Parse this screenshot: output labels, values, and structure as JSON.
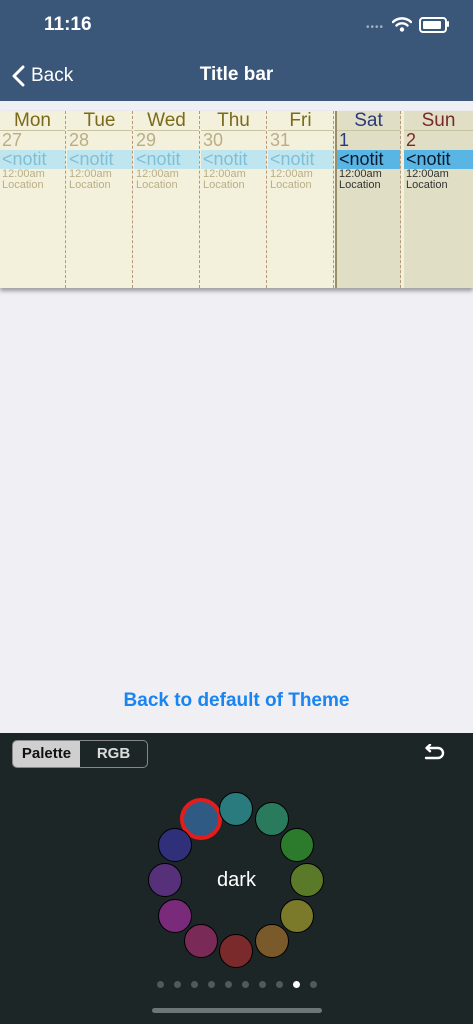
{
  "status": {
    "time": "11:16",
    "signal": "••••"
  },
  "nav": {
    "back_label": "Back",
    "title": "Title bar"
  },
  "calendar": {
    "days": [
      {
        "dow": "Mon",
        "date": "27",
        "event": "<notit",
        "time": "12:00am",
        "location": "Location"
      },
      {
        "dow": "Tue",
        "date": "28",
        "event": "<notit",
        "time": "12:00am",
        "location": "Location"
      },
      {
        "dow": "Wed",
        "date": "29",
        "event": "<notit",
        "time": "12:00am",
        "location": "Location"
      },
      {
        "dow": "Thu",
        "date": "30",
        "event": "<notit",
        "time": "12:00am",
        "location": "Location"
      },
      {
        "dow": "Fri",
        "date": "31",
        "event": "<notit",
        "time": "12:00am",
        "location": "Location"
      },
      {
        "dow": "Sat",
        "date": "1",
        "event": "<notit",
        "time": "12:00am",
        "location": "Location"
      },
      {
        "dow": "Sun",
        "date": "2",
        "event": "<notit",
        "time": "12:00am",
        "location": "Location"
      }
    ]
  },
  "reset_label": "Back to default of Theme",
  "panel": {
    "segments": [
      "Palette",
      "RGB"
    ],
    "active_segment": "Palette",
    "center_label": "dark",
    "palette_colors": [
      "#2f5a83",
      "#2a7b7d",
      "#2a7a5e",
      "#2c7a2c",
      "#5a7a2a",
      "#7a7a2a",
      "#7a5a2a",
      "#7a2a2a",
      "#7a2a57",
      "#7a2a7a",
      "#57307a",
      "#30307a"
    ],
    "selected_index": 0,
    "page_count": 10,
    "current_page": 8
  }
}
